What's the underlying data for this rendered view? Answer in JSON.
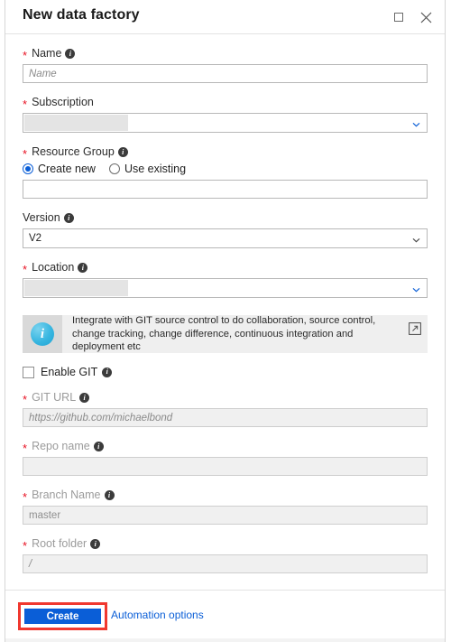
{
  "window": {
    "title": "New data factory",
    "maximize_icon": "maximize-icon",
    "close_icon": "close-icon"
  },
  "form": {
    "name": {
      "label": "Name",
      "required": true,
      "placeholder": "Name",
      "value": ""
    },
    "subscription": {
      "label": "Subscription",
      "required": true,
      "value": "",
      "redacted": true
    },
    "resource_group": {
      "label": "Resource Group",
      "required": true,
      "options": [
        "Create new",
        "Use existing"
      ],
      "selected": "Create new",
      "value": ""
    },
    "version": {
      "label": "Version",
      "required": false,
      "value": "V2",
      "options": [
        "V2"
      ]
    },
    "location": {
      "label": "Location",
      "required": true,
      "value": "",
      "redacted": true
    },
    "git_banner": {
      "icon": "info-icon",
      "text": "Integrate with GIT source control to do collaboration, source control, change tracking, change difference, continuous integration and deployment etc",
      "external_link_icon": "external-link-icon"
    },
    "enable_git": {
      "label": "Enable GIT",
      "checked": false
    },
    "git_url": {
      "label": "GIT URL",
      "required": true,
      "placeholder": "https://github.com/michaelbond",
      "value": "",
      "disabled": true
    },
    "repo_name": {
      "label": "Repo name",
      "required": true,
      "placeholder": "",
      "value": "",
      "disabled": true
    },
    "branch_name": {
      "label": "Branch Name",
      "required": true,
      "value": "master",
      "disabled": true
    },
    "root_folder": {
      "label": "Root folder",
      "required": true,
      "placeholder": "/",
      "value": "",
      "disabled": true
    }
  },
  "footer": {
    "create_label": "Create",
    "automation_label": "Automation options"
  },
  "colors": {
    "accent": "#0a5ed7",
    "required": "#e81123",
    "highlight": "#f0382f",
    "banner_bg": "#efefef",
    "disabled_bg": "#f0f0f0"
  }
}
